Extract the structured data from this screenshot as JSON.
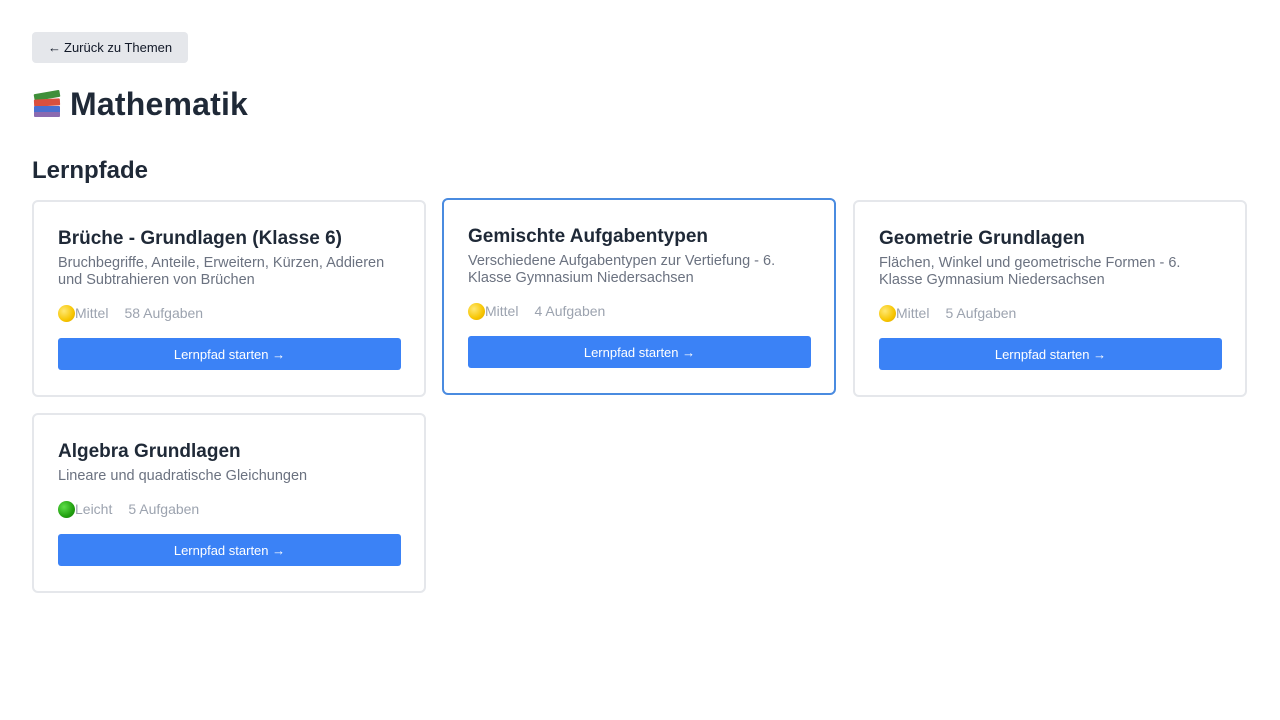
{
  "nav": {
    "back_label": "Zurück zu Themen",
    "back_arrow": "←"
  },
  "header": {
    "icon": "books-icon",
    "title": "Mathematik"
  },
  "section": {
    "title": "Lernpfade"
  },
  "cards": [
    {
      "title": "Brüche - Grundlagen (Klasse 6)",
      "description": "Bruchbegriffe, Anteile, Erweitern, Kürzen, Addieren und Subtrahieren von Brüchen",
      "level": "Mittel",
      "level_color": "#f7c500",
      "tasks": "58 Aufgaben",
      "button": "Lernpfad starten →",
      "highlighted": false
    },
    {
      "title": "Gemischte Aufgabentypen",
      "description": "Verschiedene Aufgabentypen zur Vertiefung - 6. Klasse Gymnasium Niedersachsen",
      "level": "Mittel",
      "level_color": "#f7c500",
      "tasks": "4 Aufgaben",
      "button": "Lernpfad starten →",
      "highlighted": true
    },
    {
      "title": "Geometrie Grundlagen",
      "description": "Flächen, Winkel und geometrische Formen - 6. Klasse Gymnasium Niedersachsen",
      "level": "Mittel",
      "level_color": "#f7c500",
      "tasks": "5 Aufgaben",
      "button": "Lernpfad starten →",
      "highlighted": false
    },
    {
      "title": "Algebra Grundlagen",
      "description": "Lineare und quadratische Gleichungen",
      "level": "Leicht",
      "level_color": "#22a010",
      "tasks": "5 Aufgaben",
      "button": "Lernpfad starten →",
      "highlighted": false
    }
  ],
  "colors": {
    "accent": "#3b82f6",
    "highlight_border": "#4a8be0",
    "card_border": "#e5e7eb",
    "muted_text": "#6b7280"
  }
}
